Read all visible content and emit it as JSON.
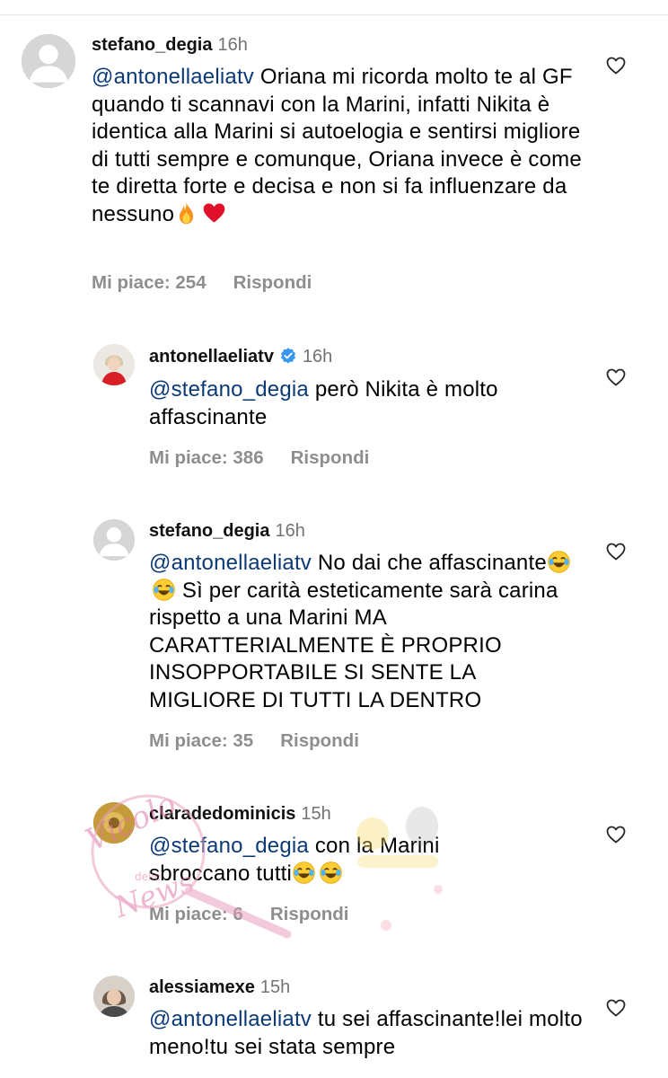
{
  "colors": {
    "mention": "#0b3a77",
    "meta": "#8e8e8e",
    "verified": "#3897f0"
  },
  "comments": [
    {
      "username": "stefano_degia",
      "time": "16h",
      "mention": "@antonellaeliatv",
      "text": " Oriana mi ricorda molto te al GF quando ti scannavi con la Marini, infatti Nikita è identica alla Marini si autoelogia e sentirsi migliore di tutti sempre e comunque, Oriana invece è come te diretta forte e decisa e non si fa influenzare da nessuno",
      "emojis": [
        "fire-emoji",
        "red-heart-emoji"
      ],
      "likes": "Mi piace: 254",
      "reply": "Rispondi"
    },
    {
      "username": "antonellaeliatv",
      "verified": true,
      "time": "16h",
      "mention": "@stefano_degia",
      "text": " però Nikita è molto affascinante",
      "likes": "Mi piace: 386",
      "reply": "Rispondi"
    },
    {
      "username": "stefano_degia",
      "time": "16h",
      "mention": "@antonellaeliatv",
      "text_a": " No dai che affascinante",
      "text_b": " Sì per carità esteticamente sarà carina rispetto a una Marini MA CARATTERIALMENTE È PROPRIO INSOPPORTABILE SI SENTE LA MIGLIORE DI TUTTI LA DENTRO",
      "emojis": [
        "laughing-emoji",
        "laughing-emoji"
      ],
      "likes": "Mi piace: 35",
      "reply": "Rispondi"
    },
    {
      "username": "claradedominicis",
      "time": "15h",
      "mention": "@stefano_degia",
      "text": " con la Marini sbroccano tutti",
      "emojis": [
        "laughing-emoji",
        "laughing-emoji"
      ],
      "likes": "Mi piace: 6",
      "reply": "Rispondi"
    },
    {
      "username": "alessiamexe",
      "time": "15h",
      "mention": "@antonellaeliatv",
      "text": " tu sei affascinante!lei molto meno!tu sei stata sempre",
      "likes": "",
      "reply": ""
    }
  ],
  "watermark": {
    "line1": "Vicolo",
    "line2": "delle",
    "line3": "News"
  }
}
